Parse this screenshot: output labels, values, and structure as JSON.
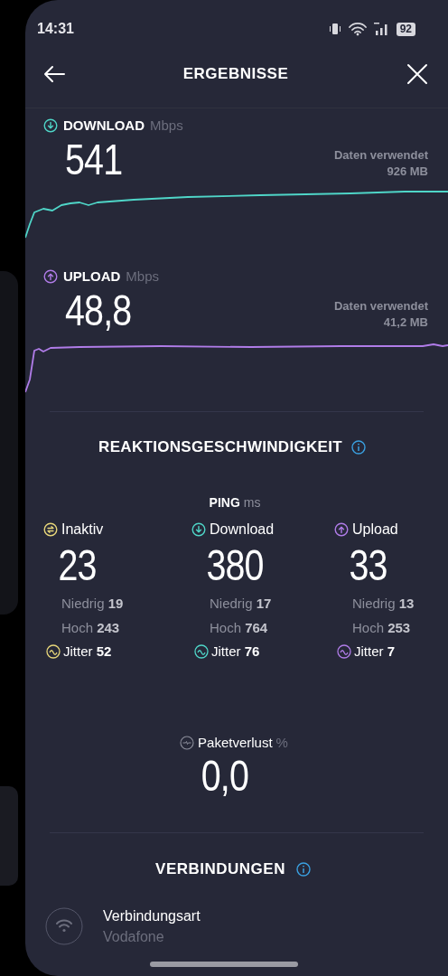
{
  "status_bar": {
    "time": "14:31",
    "battery": "92"
  },
  "header": {
    "title": "ERGEBNISSE"
  },
  "speeds": [
    {
      "kind": "download",
      "label": "DOWNLOAD",
      "unit": "Mbps",
      "value": "541",
      "data_label": "Daten verwendet",
      "data_value": "926 MB",
      "color": "#4fd6c8"
    },
    {
      "kind": "upload",
      "label": "UPLOAD",
      "unit": "Mbps",
      "value": "48,8",
      "data_label": "Daten verwendet",
      "data_value": "41,2 MB",
      "color": "#b07ce8"
    }
  ],
  "responsiveness": {
    "title": "REAKTIONSGESCHWINDIGKEIT",
    "ping_label": "PING",
    "ping_unit": "ms",
    "columns": [
      {
        "kind": "idle",
        "label": "Inaktiv",
        "value": "23",
        "low_label": "Niedrig",
        "low": "19",
        "high_label": "Hoch",
        "high": "243",
        "jitter_label": "Jitter",
        "jitter": "52",
        "color": "#e8d77a"
      },
      {
        "kind": "download",
        "label": "Download",
        "value": "380",
        "low_label": "Niedrig",
        "low": "17",
        "high_label": "Hoch",
        "high": "764",
        "jitter_label": "Jitter",
        "jitter": "76",
        "color": "#4fd6c8"
      },
      {
        "kind": "upload",
        "label": "Upload",
        "value": "33",
        "low_label": "Niedrig",
        "low": "13",
        "high_label": "Hoch",
        "high": "253",
        "jitter_label": "Jitter",
        "jitter": "7",
        "color": "#b07ce8"
      }
    ]
  },
  "packet_loss": {
    "label": "Paketverlust",
    "unit": "%",
    "value": "0,0"
  },
  "connections": {
    "title": "VERBINDUNGEN",
    "items": [
      {
        "label": "Verbindungsart",
        "value": "Vodafone"
      }
    ]
  }
}
